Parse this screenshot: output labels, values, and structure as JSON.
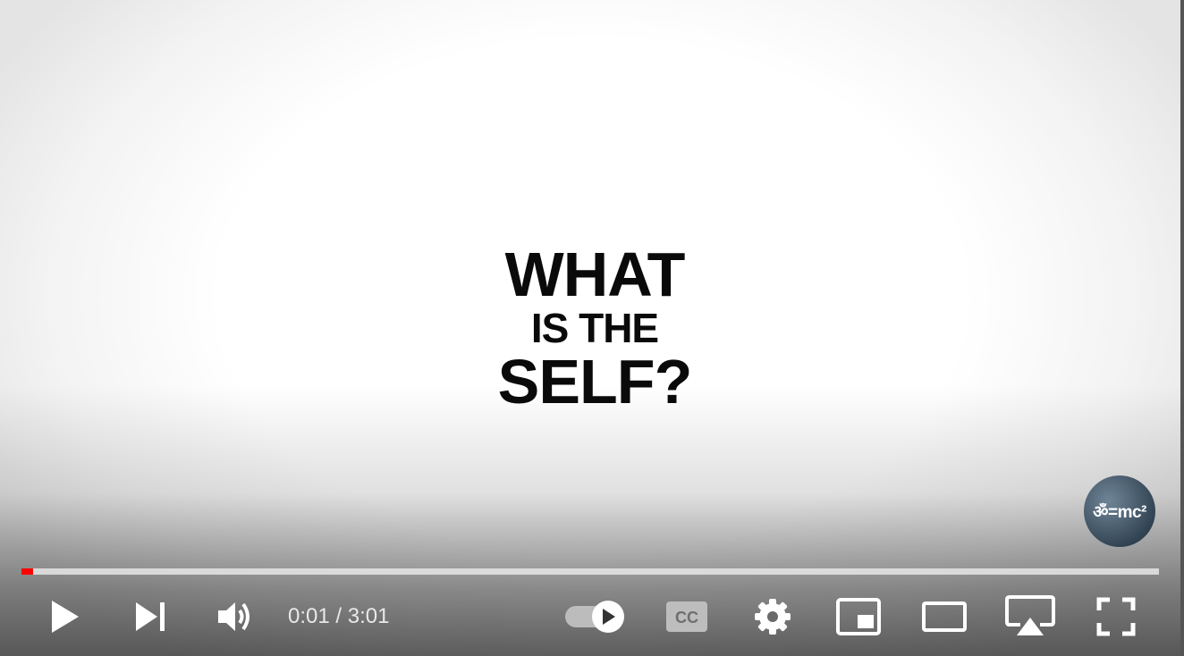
{
  "video": {
    "title_card": {
      "line1": "WHAT",
      "line2": "IS THE",
      "line3": "SELF?"
    },
    "watermark_text": "ॐ=mc²"
  },
  "player": {
    "progress": {
      "fraction": 0.0105,
      "color": "#ff0000"
    },
    "time": {
      "current": "0:01",
      "separator": " / ",
      "duration": "3:01"
    },
    "controls": [
      {
        "name": "play-button",
        "icon": "play-icon"
      },
      {
        "name": "next-button",
        "icon": "skip-next-icon"
      },
      {
        "name": "volume-button",
        "icon": "volume-icon"
      },
      {
        "name": "autoplay-toggle",
        "icon": "autoplay-toggle-icon",
        "state": "on"
      },
      {
        "name": "subtitles-button",
        "icon": "closed-captions-icon",
        "label": "CC"
      },
      {
        "name": "settings-button",
        "icon": "gear-icon"
      },
      {
        "name": "miniplayer-button",
        "icon": "miniplayer-icon"
      },
      {
        "name": "theater-mode-button",
        "icon": "theater-icon"
      },
      {
        "name": "airplay-button",
        "icon": "airplay-icon"
      },
      {
        "name": "fullscreen-button",
        "icon": "fullscreen-icon"
      }
    ]
  }
}
